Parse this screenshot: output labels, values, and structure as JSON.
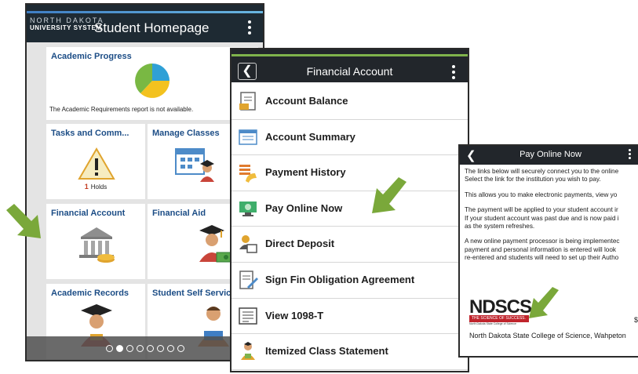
{
  "homepage": {
    "logo_line1": "NORTH DAKOTA",
    "logo_line2": "UNIVERSITY SYSTEM",
    "title": "Student Homepage",
    "tiles": [
      {
        "title": "Academic Progress",
        "note": "The Academic Requirements report is not available."
      },
      {
        "title": "Tasks and Comm...",
        "holds_count": "1",
        "holds_label": "Holds"
      },
      {
        "title": "Manage Classes"
      },
      {
        "title": "Financial Account"
      },
      {
        "title": "Financial Aid"
      },
      {
        "title": "Academic Records"
      },
      {
        "title": "Student Self Service"
      }
    ],
    "pager": {
      "pages": 8,
      "active_index": 1
    }
  },
  "financial_account": {
    "title": "Financial Account",
    "items": [
      {
        "label": "Account Balance",
        "icon": "account-balance-icon"
      },
      {
        "label": "Account Summary",
        "icon": "account-summary-icon"
      },
      {
        "label": "Payment History",
        "icon": "payment-history-icon"
      },
      {
        "label": "Pay Online Now",
        "icon": "pay-online-icon"
      },
      {
        "label": "Direct Deposit",
        "icon": "direct-deposit-icon"
      },
      {
        "label": "Sign Fin Obligation Agreement",
        "icon": "sign-agreement-icon"
      },
      {
        "label": "View 1098-T",
        "icon": "tax-form-icon"
      },
      {
        "label": "Itemized Class Statement",
        "icon": "class-statement-icon"
      }
    ]
  },
  "pay_online": {
    "title": "Pay Online Now",
    "paragraphs": [
      [
        "The links below will securely connect you to the online",
        "Select the link for the institution you wish to pay."
      ],
      [
        "This allows you to make electronic payments, view yo"
      ],
      [
        "The payment will be applied to your student account ir",
        "If your student account was past due and is now paid i",
        "as the system refreshes."
      ],
      [
        "A new online payment processor is being implementec",
        "payment and personal information is entered will look",
        "re-entered and students will need to set up their Autho"
      ]
    ],
    "institution": {
      "logo_text": "NDSCS",
      "logo_tagline": "THE SCIENCE OF SUCCESS.",
      "logo_subtitle": "North Dakota State College of Science",
      "name": "North Dakota State College of Science, Wahpeton",
      "amount_partial": "$"
    }
  },
  "colors": {
    "tile_title": "#1c4d86",
    "arrow_green": "#7aa83a",
    "header_dark": "#22262b",
    "accent_green": "#7fb34c"
  }
}
